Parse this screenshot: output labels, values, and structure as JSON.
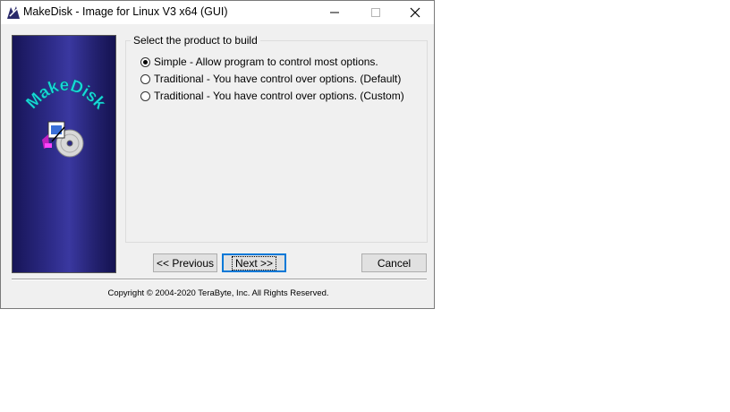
{
  "window": {
    "title": "MakeDisk - Image for Linux V3 x64 (GUI)",
    "minimize_glyph": "—",
    "maximize_glyph": "☐",
    "close_glyph": "✕"
  },
  "banner": {
    "logo_text": "MakeDisk"
  },
  "group": {
    "title": "Select the product to build",
    "options": [
      {
        "label": "Simple - Allow program to control most options.",
        "checked": true
      },
      {
        "label": "Traditional - You have control over options. (Default)",
        "checked": false
      },
      {
        "label": "Traditional - You have control over options. (Custom)",
        "checked": false
      }
    ]
  },
  "buttons": {
    "previous": "<< Previous",
    "next": "Next >>",
    "cancel": "Cancel"
  },
  "footer": {
    "copyright": "Copyright © 2004-2020 TeraByte, Inc.  All Rights Reserved."
  },
  "colors": {
    "banner_dark": "#171557",
    "banner_light": "#3a38a0",
    "logo_text": "#17d8d8",
    "focus_border": "#0078d7"
  }
}
